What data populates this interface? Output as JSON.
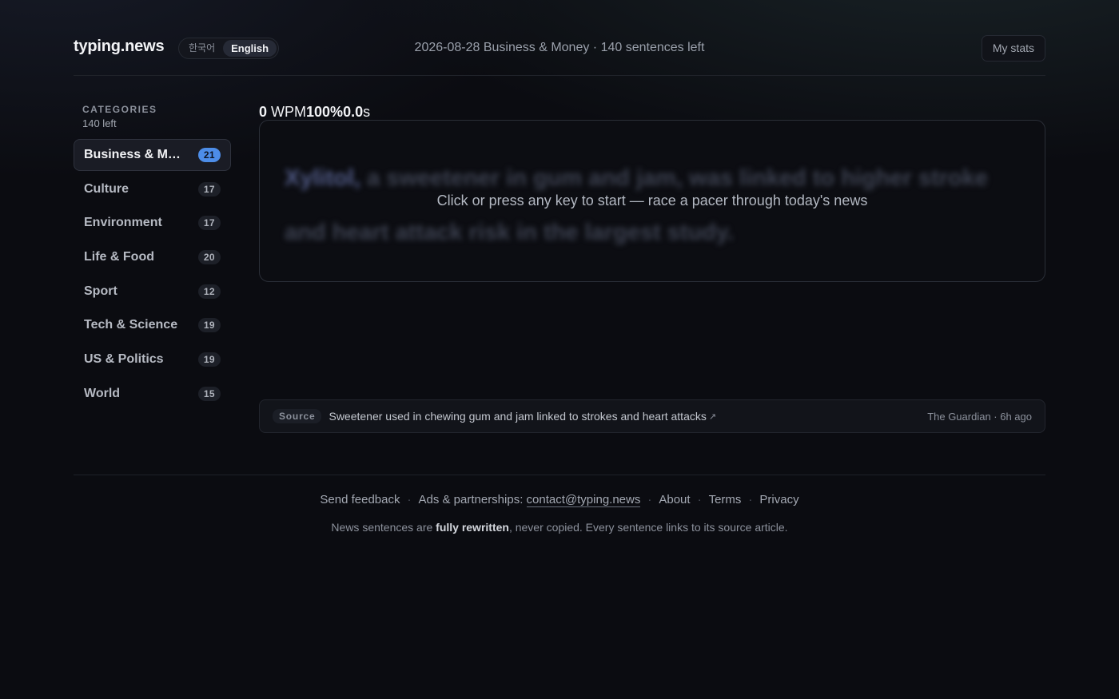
{
  "header": {
    "logo": "typing.news",
    "lang_ko": "한국어",
    "lang_en": "English",
    "info": "2026-08-28 Business & Money · 140 sentences left",
    "stats_button": "My stats"
  },
  "sidebar": {
    "title": "CATEGORIES",
    "left": "140 left",
    "items": [
      {
        "label": "Business & Money",
        "count": "21"
      },
      {
        "label": "Culture",
        "count": "17"
      },
      {
        "label": "Environment",
        "count": "17"
      },
      {
        "label": "Life & Food",
        "count": "20"
      },
      {
        "label": "Sport",
        "count": "12"
      },
      {
        "label": "Tech & Science",
        "count": "19"
      },
      {
        "label": "US & Politics",
        "count": "19"
      },
      {
        "label": "World",
        "count": "15"
      }
    ]
  },
  "metrics": {
    "wpm_value": "0",
    "wpm_unit": " WPM",
    "accuracy": "100%",
    "time_value": "0.0",
    "time_unit": "s"
  },
  "typing": {
    "first_word": "Xylitol,",
    "rest": " a sweetener in gum and jam, was linked to higher stroke and heart attack risk in the largest study.",
    "prompt": "Click or press any key to start — race a pacer through today's news"
  },
  "source": {
    "badge": "Source",
    "title": "Sweetener used in chewing gum and jam linked to strokes and heart attacks",
    "arrow": "↗",
    "meta": "The Guardian · 6h ago"
  },
  "footer": {
    "feedback": "Send feedback",
    "ads_label": "Ads & partnerships: ",
    "ads_email": "contact@typing.news",
    "about": "About",
    "terms": "Terms",
    "privacy": "Privacy",
    "sep": "·",
    "note_pre": "News sentences are ",
    "note_bold": "fully rewritten",
    "note_post": ", never copied. Every sentence links to its source article."
  },
  "colors": {
    "accent": "#4d8de8",
    "background": "#0b0c11"
  }
}
